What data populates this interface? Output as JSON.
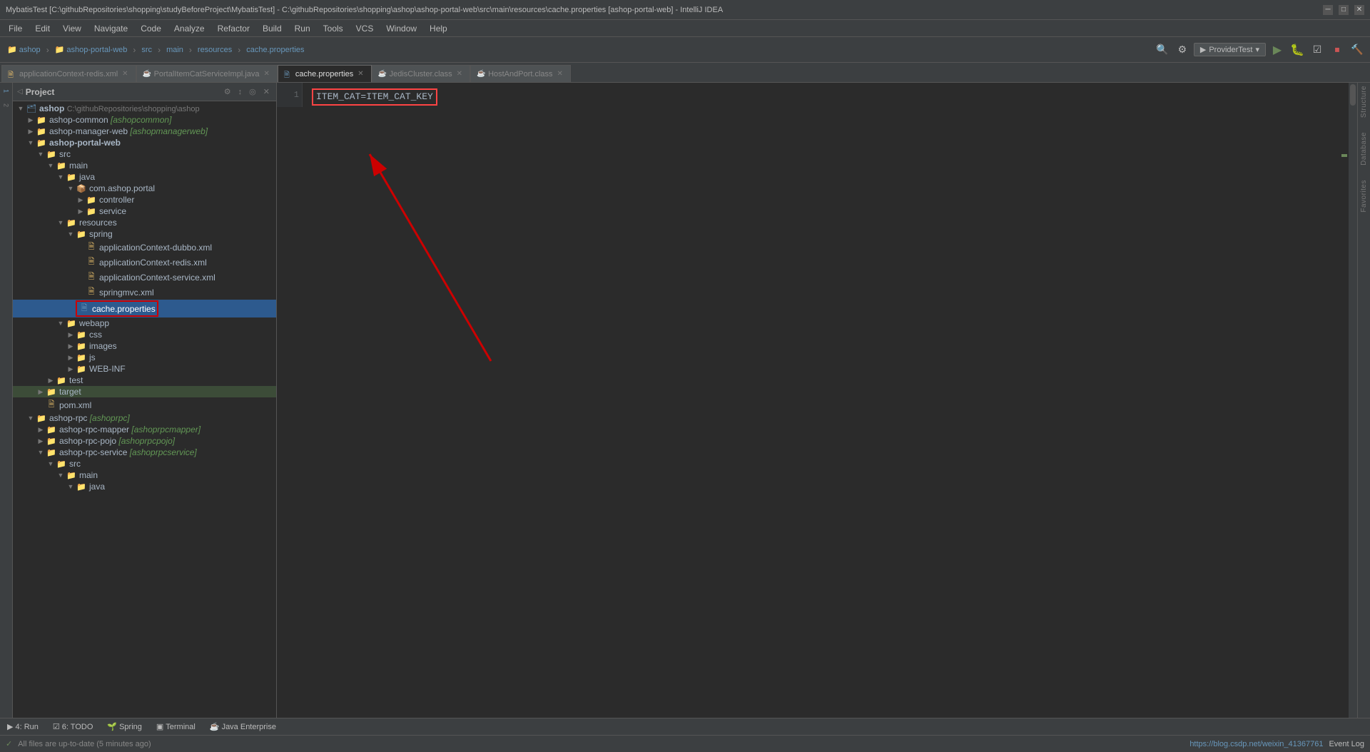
{
  "titleBar": {
    "title": "MybatisTest [C:\\githubRepositories\\shopping\\studyBeforeProject\\MybatisTest] - C:\\githubRepositories\\shopping\\ashop\\ashop-portal-web\\src\\main\\resources\\cache.properties [ashop-portal-web] - IntelliJ IDEA",
    "minimize": "─",
    "maximize": "□",
    "close": "✕"
  },
  "menuBar": {
    "items": [
      "File",
      "Edit",
      "View",
      "Navigate",
      "Code",
      "Analyze",
      "Refactor",
      "Build",
      "Run",
      "Tools",
      "VCS",
      "Window",
      "Help"
    ]
  },
  "toolbar": {
    "breadcrumbs": [
      "ashop",
      "ashop-portal-web",
      "src",
      "main",
      "resources",
      "cache.properties"
    ],
    "providerTest": "ProviderTest"
  },
  "tabs": [
    {
      "label": "applicationContext-redis.xml",
      "icon": "📄",
      "active": false,
      "closeable": true
    },
    {
      "label": "PortalItemCatServiceImpl.java",
      "icon": "☕",
      "active": false,
      "closeable": true
    },
    {
      "label": "cache.properties",
      "icon": "📄",
      "active": true,
      "closeable": true
    },
    {
      "label": "JedisCluster.class",
      "icon": "☕",
      "active": false,
      "closeable": true
    },
    {
      "label": "HostAndPort.class",
      "icon": "☕",
      "active": false,
      "closeable": true
    }
  ],
  "projectPanel": {
    "title": "Project",
    "rootNodes": [
      {
        "id": "ashop",
        "label": "ashop",
        "path": "C:\\githubRepositories\\shopping\\ashop",
        "level": 0,
        "expanded": true,
        "type": "project"
      }
    ],
    "treeItems": [
      {
        "id": "ashop-common",
        "label": "ashop-common",
        "module": "[ashopcommon]",
        "level": 1,
        "expanded": false,
        "type": "module"
      },
      {
        "id": "ashop-manager-web",
        "label": "ashop-manager-web",
        "module": "[ashopmanagerweb]",
        "level": 1,
        "expanded": false,
        "type": "module"
      },
      {
        "id": "ashop-portal-web",
        "label": "ashop-portal-web",
        "level": 1,
        "expanded": true,
        "type": "module"
      },
      {
        "id": "src",
        "label": "src",
        "level": 2,
        "expanded": true,
        "type": "folder"
      },
      {
        "id": "main",
        "label": "main",
        "level": 3,
        "expanded": true,
        "type": "folder"
      },
      {
        "id": "java",
        "label": "java",
        "level": 4,
        "expanded": true,
        "type": "source-folder"
      },
      {
        "id": "com.ashop.portal",
        "label": "com.ashop.portal",
        "level": 5,
        "expanded": true,
        "type": "package"
      },
      {
        "id": "controller",
        "label": "controller",
        "level": 6,
        "expanded": false,
        "type": "package"
      },
      {
        "id": "service",
        "label": "service",
        "level": 6,
        "expanded": false,
        "type": "package"
      },
      {
        "id": "resources",
        "label": "resources",
        "level": 4,
        "expanded": true,
        "type": "resource-folder"
      },
      {
        "id": "spring",
        "label": "spring",
        "level": 5,
        "expanded": true,
        "type": "folder"
      },
      {
        "id": "applicationContext-dubbo.xml",
        "label": "applicationContext-dubbo.xml",
        "level": 6,
        "expanded": false,
        "type": "xml"
      },
      {
        "id": "applicationContext-redis.xml",
        "label": "applicationContext-redis.xml",
        "level": 6,
        "expanded": false,
        "type": "xml"
      },
      {
        "id": "applicationContext-service.xml",
        "label": "applicationContext-service.xml",
        "level": 6,
        "expanded": false,
        "type": "xml"
      },
      {
        "id": "springmvc.xml",
        "label": "springmvc.xml",
        "level": 6,
        "expanded": false,
        "type": "xml"
      },
      {
        "id": "cache.properties",
        "label": "cache.properties",
        "level": 5,
        "expanded": false,
        "type": "properties",
        "selected": true
      },
      {
        "id": "webapp",
        "label": "webapp",
        "level": 4,
        "expanded": true,
        "type": "folder"
      },
      {
        "id": "css",
        "label": "css",
        "level": 5,
        "expanded": false,
        "type": "folder"
      },
      {
        "id": "images",
        "label": "images",
        "level": 5,
        "expanded": false,
        "type": "folder"
      },
      {
        "id": "js",
        "label": "js",
        "level": 5,
        "expanded": false,
        "type": "folder"
      },
      {
        "id": "WEB-INF",
        "label": "WEB-INF",
        "level": 5,
        "expanded": false,
        "type": "folder"
      },
      {
        "id": "test",
        "label": "test",
        "level": 3,
        "expanded": false,
        "type": "folder"
      },
      {
        "id": "target",
        "label": "target",
        "level": 2,
        "expanded": false,
        "type": "folder"
      },
      {
        "id": "pom.xml",
        "label": "pom.xml",
        "level": 2,
        "expanded": false,
        "type": "xml"
      },
      {
        "id": "ashop-rpc",
        "label": "ashop-rpc",
        "module": "[ashoprpc]",
        "level": 1,
        "expanded": true,
        "type": "module"
      },
      {
        "id": "ashop-rpc-mapper",
        "label": "ashop-rpc-mapper",
        "module": "[ashoprpcmapper]",
        "level": 2,
        "expanded": false,
        "type": "module"
      },
      {
        "id": "ashop-rpc-pojo",
        "label": "ashop-rpc-pojo",
        "module": "[ashoprpcpojo]",
        "level": 2,
        "expanded": false,
        "type": "module"
      },
      {
        "id": "ashop-rpc-service",
        "label": "ashop-rpc-service",
        "module": "[ashoprpcservice]",
        "level": 2,
        "expanded": true,
        "type": "module"
      },
      {
        "id": "rpc-src",
        "label": "src",
        "level": 3,
        "expanded": true,
        "type": "folder"
      },
      {
        "id": "rpc-main",
        "label": "main",
        "level": 4,
        "expanded": true,
        "type": "folder"
      },
      {
        "id": "rpc-java",
        "label": "java",
        "level": 5,
        "expanded": true,
        "type": "source-folder"
      }
    ]
  },
  "editor": {
    "lineNumbers": [
      "1"
    ],
    "content": "ITEM_CAT=ITEM_CAT_KEY",
    "highlightedText": "ITEM_CAT=ITEM_CAT_KEY"
  },
  "rightSidebar": {
    "tools": [
      "1: Project",
      "2: Structure",
      "Database",
      "Favorites"
    ]
  },
  "bottomBar": {
    "buttons": [
      {
        "icon": "▶",
        "label": "4: Run"
      },
      {
        "icon": "☑",
        "label": "6: TODO"
      },
      {
        "icon": "🌱",
        "label": "Spring"
      },
      {
        "icon": "▣",
        "label": "Terminal"
      },
      {
        "icon": "☕",
        "label": "Java Enterprise"
      }
    ],
    "status": "All files are up-to-date (5 minutes ago)",
    "url": "https://blog.csdp.net/weixin_41367761",
    "eventLog": "Event Log"
  },
  "icons": {
    "folder": "📁",
    "java-source": "📂",
    "xml-file": "🗎",
    "properties-file": "🗎",
    "package": "📦",
    "arrow-collapsed": "▶",
    "arrow-expanded": "▼",
    "settings": "⚙",
    "gear": "⚙",
    "run": "▶",
    "debug": "🐛",
    "stop": "⏹",
    "back": "←",
    "forward": "→"
  }
}
